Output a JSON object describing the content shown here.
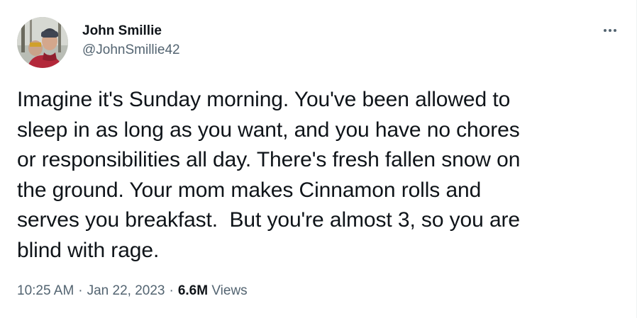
{
  "author": {
    "display_name": "John Smillie",
    "handle": "@JohnSmillie42"
  },
  "tweet": {
    "text": "Imagine it's Sunday morning. You've been allowed to\nsleep in as long as you want, and you have no chores\nor responsibilities all day. There's fresh fallen snow on\nthe ground. Your mom makes Cinnamon rolls and\nserves you breakfast.  But you're almost 3, so you are\nblind with rage.",
    "time": "10:25 AM",
    "separator": "·",
    "date": "Jan 22, 2023",
    "views_count": "6.6M",
    "views_label": "Views"
  },
  "icons": {
    "more": "more-horizontal-icon",
    "avatar": "profile-photo"
  },
  "colors": {
    "text_primary": "#0f1419",
    "text_secondary": "#536471",
    "background": "#ffffff"
  }
}
